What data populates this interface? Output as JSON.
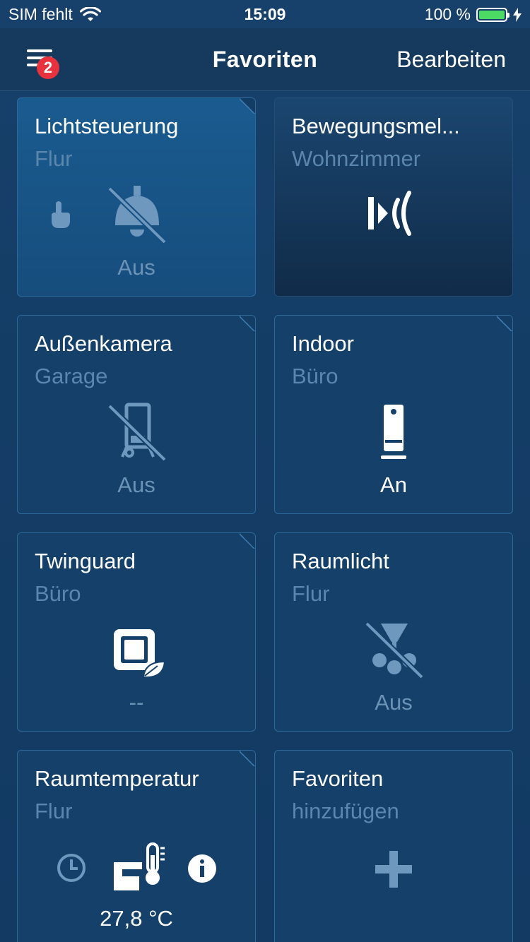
{
  "status_bar": {
    "carrier": "SIM fehlt",
    "time": "15:09",
    "battery": "100 %"
  },
  "nav": {
    "badge_count": "2",
    "title": "Favoriten",
    "edit_label": "Bearbeiten"
  },
  "tiles": [
    {
      "name": "Lichtsteuerung",
      "room": "Flur",
      "state": "Aus",
      "icons": [
        "touch-icon",
        "ceiling-light-off-icon"
      ]
    },
    {
      "name": "Bewegungsmel...",
      "room": "Wohnzimmer",
      "state": "",
      "icons": [
        "motion-sensor-icon"
      ]
    },
    {
      "name": "Außenkamera",
      "room": "Garage",
      "state": "Aus",
      "icons": [
        "camera-off-icon"
      ]
    },
    {
      "name": "Indoor",
      "room": "Büro",
      "state": "An",
      "icons": [
        "indoor-camera-icon"
      ]
    },
    {
      "name": "Twinguard",
      "room": "Büro",
      "state": "--",
      "icons": [
        "twinguard-icon"
      ]
    },
    {
      "name": "Raumlicht",
      "room": "Flur",
      "state": "Aus",
      "icons": [
        "room-light-off-icon"
      ]
    },
    {
      "name": "Raumtemperatur",
      "room": "Flur",
      "state": "27,8 °C",
      "icons": [
        "clock-icon",
        "thermostat-icon",
        "info-icon"
      ]
    },
    {
      "name": "Favoriten",
      "room": "hinzufügen",
      "state": "",
      "icons": [
        "plus-icon"
      ]
    }
  ],
  "colors": {
    "background": "#143d66",
    "tile_border": "#2d6a9c",
    "muted_text": "#5b86ad",
    "badge": "#e8323e",
    "battery": "#4cd964"
  }
}
